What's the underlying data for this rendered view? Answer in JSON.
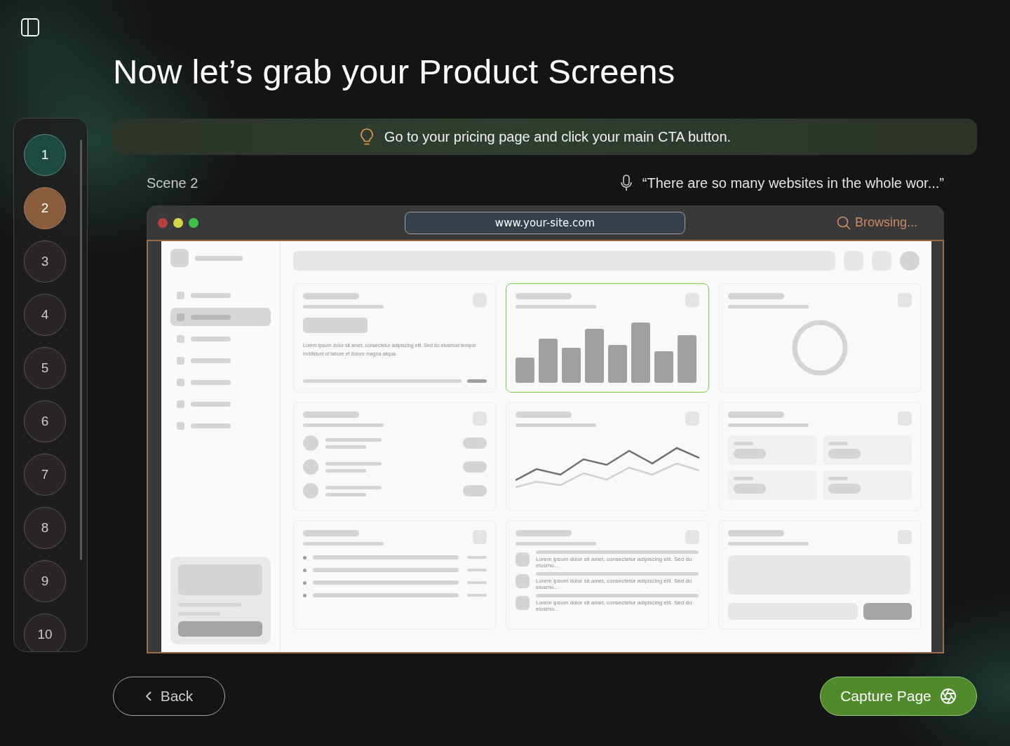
{
  "title": "Now let’s grab your Product Screens",
  "steps": [
    {
      "label": "1",
      "done": true,
      "selected": false
    },
    {
      "label": "2",
      "done": false,
      "selected": true
    },
    {
      "label": "3",
      "done": false,
      "selected": false
    },
    {
      "label": "4",
      "done": false,
      "selected": false
    },
    {
      "label": "5",
      "done": false,
      "selected": false
    },
    {
      "label": "6",
      "done": false,
      "selected": false
    },
    {
      "label": "7",
      "done": false,
      "selected": false
    },
    {
      "label": "8",
      "done": false,
      "selected": false
    },
    {
      "label": "9",
      "done": false,
      "selected": false
    },
    {
      "label": "10",
      "done": false,
      "selected": false
    }
  ],
  "hint": "Go to your pricing page and click your main CTA button.",
  "scene": {
    "label": "Scene 2",
    "quote": "“There are so many websites in the whole wor...”"
  },
  "browser": {
    "url": "www.your-site.com",
    "status": "Browsing..."
  },
  "mock_page": {
    "nav": [
      {
        "selected": false
      },
      {
        "selected": true
      },
      {
        "selected": false
      },
      {
        "selected": false
      },
      {
        "selected": false
      },
      {
        "selected": false
      },
      {
        "selected": false
      }
    ],
    "cards": [
      {
        "kind": "summary",
        "selected": false,
        "text": "Lorem ipsum dolor sit amet, consectetur adipiscing elit. Sed do eiusmod tempor incididunt ut labore et dolore magna aliqua."
      },
      {
        "kind": "bars",
        "selected": true
      },
      {
        "kind": "ring",
        "selected": false
      },
      {
        "kind": "avatars",
        "selected": false
      },
      {
        "kind": "line",
        "selected": false
      },
      {
        "kind": "stats",
        "selected": false
      },
      {
        "kind": "bullets",
        "selected": false
      },
      {
        "kind": "notes",
        "selected": false,
        "notes": [
          "Lorem ipsum dolor sit amet, consectetur adipiscing elit. Sed do eiusmo...",
          "Lorem ipsum dolor sit amet, consectetur adipiscing elit. Sed do eiusmo...",
          "Lorem ipsum dolor sit amet, consectetur adipiscing elit. Sed do eiusmo..."
        ]
      },
      {
        "kind": "form",
        "selected": false
      }
    ]
  },
  "buttons": {
    "back": "Back",
    "capture": "Capture Page"
  }
}
